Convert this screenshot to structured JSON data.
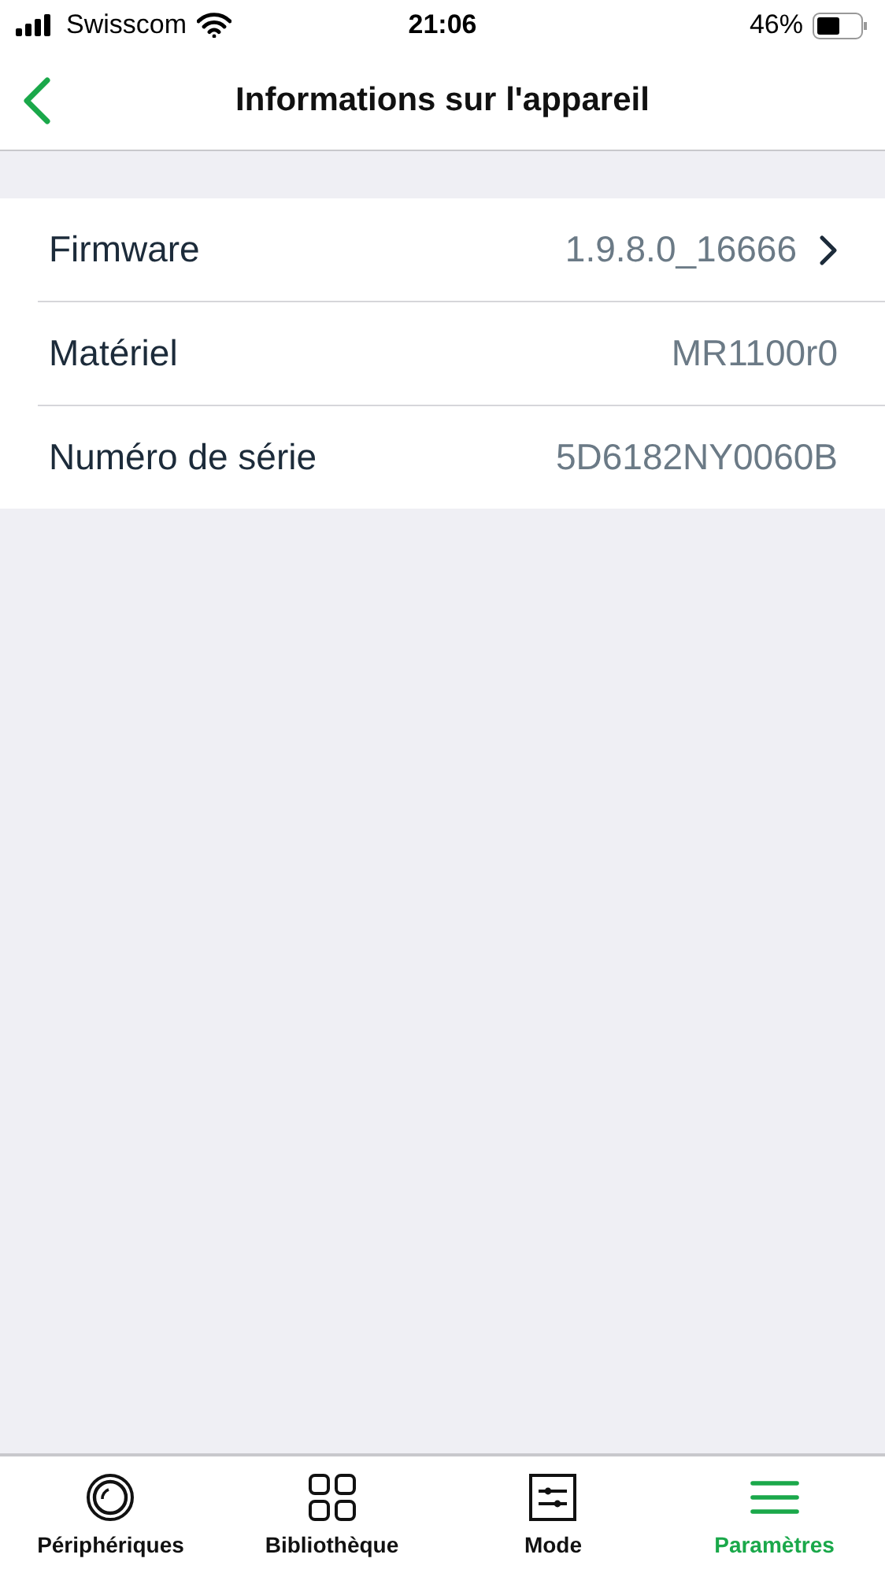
{
  "status_bar": {
    "carrier": "Swisscom",
    "time": "21:06",
    "battery": "46%"
  },
  "nav": {
    "title": "Informations sur l'appareil"
  },
  "rows": [
    {
      "kind": "link",
      "label": "Firmware",
      "value": "1.9.8.0_16666"
    },
    {
      "kind": "info",
      "label": "Matériel",
      "value": "MR1100r0"
    },
    {
      "kind": "info",
      "label": "Numéro de série",
      "value": "5D6182NY0060B"
    }
  ],
  "tabs": [
    {
      "kind": "devices",
      "label": "Périphériques",
      "selected": false
    },
    {
      "kind": "library",
      "label": "Bibliothèque",
      "selected": false
    },
    {
      "kind": "mode",
      "label": "Mode",
      "selected": false
    },
    {
      "kind": "settings",
      "label": "Paramètres",
      "selected": true
    }
  ]
}
